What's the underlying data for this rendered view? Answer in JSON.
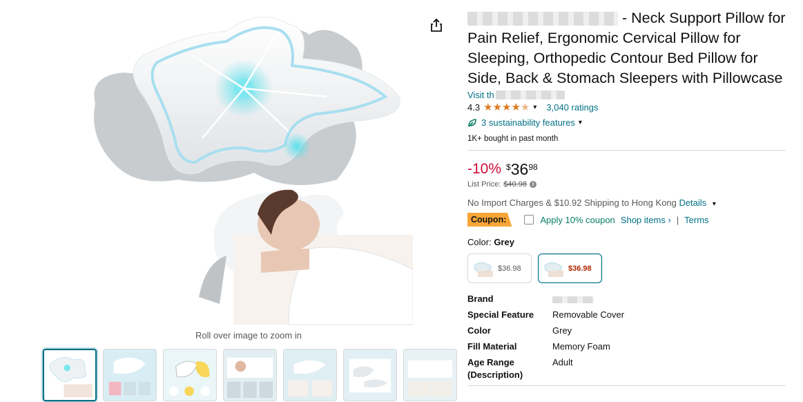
{
  "product": {
    "title": "- Neck Support Pillow for Pain Relief, Ergonomic Cervical Pillow for Sleeping, Orthopedic Contour Bed Pillow for Side, Back & Stomach Sleepers with Pillowcase",
    "visit_store": "Visit th",
    "rating": "4.3",
    "rating_stars": 4.3,
    "ratings_count": "3,040 ratings",
    "sustainability": "3 sustainability features",
    "bought": "1K+ bought in past month",
    "discount": "-10%",
    "price_symbol": "$",
    "price_whole": "36",
    "price_fraction": "98",
    "list_price_label": "List Price:",
    "list_price": "$40.98",
    "shipping_text": "No Import Charges & $10.92 Shipping to Hong Kong",
    "shipping_details": "Details",
    "coupon_badge": "Coupon:",
    "coupon_text": "Apply 10% coupon",
    "shop_items": "Shop items ›",
    "separator": "|",
    "terms": "Terms",
    "color_label": "Color:",
    "color_value": "Grey",
    "swatches": [
      {
        "price": "$36.98"
      },
      {
        "price": "$36.98"
      }
    ]
  },
  "specs": [
    {
      "key": "Brand",
      "value": ""
    },
    {
      "key": "Special Feature",
      "value": "Removable Cover"
    },
    {
      "key": "Color",
      "value": "Grey"
    },
    {
      "key": "Fill Material",
      "value": "Memory Foam"
    },
    {
      "key": "Age Range (Description)",
      "value": "Adult"
    }
  ],
  "gallery": {
    "zoom_hint": "Roll over image to zoom in"
  },
  "colors": {
    "link": "#007185",
    "discount": "#cc0c39",
    "star": "#de7921",
    "coupon": "#f7a637",
    "coupon_text": "#067d62"
  }
}
